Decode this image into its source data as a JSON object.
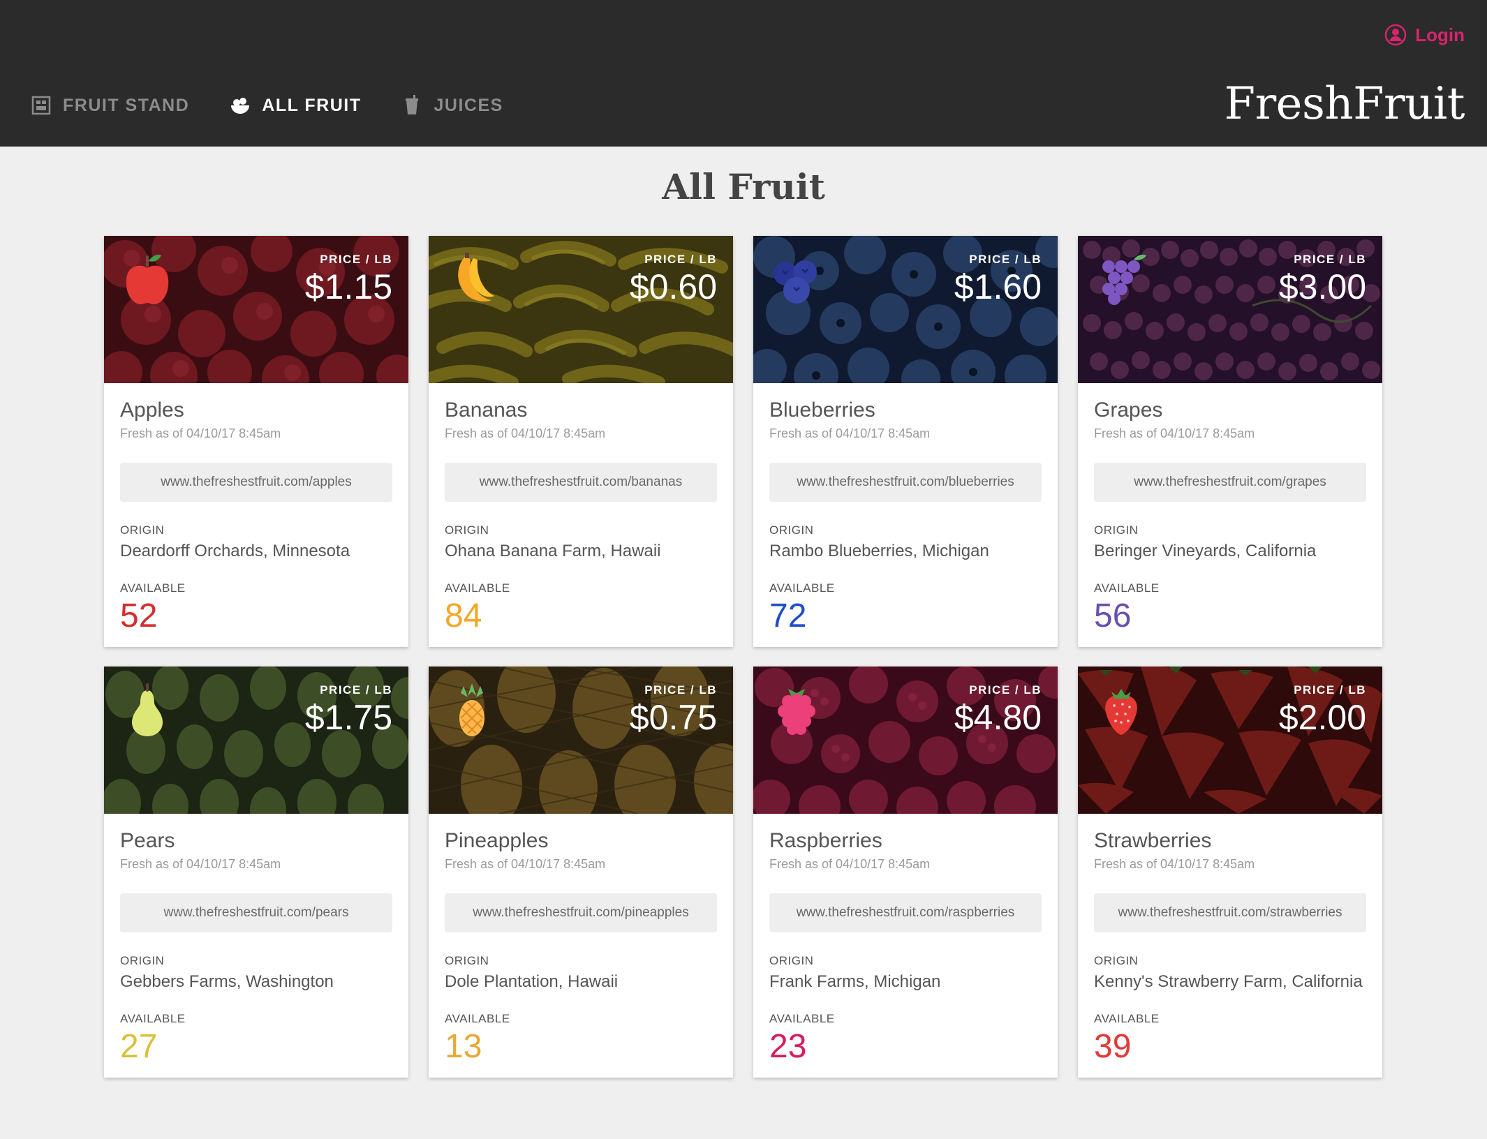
{
  "app": {
    "brand": "FreshFruit",
    "login_label": "Login",
    "accent_color": "#d8246c"
  },
  "nav": {
    "items": [
      {
        "label": "FRUIT STAND",
        "icon": "fruit-stand-icon",
        "active": false
      },
      {
        "label": "ALL FRUIT",
        "icon": "fruit-bowl-icon",
        "active": true
      },
      {
        "label": "JUICES",
        "icon": "juice-cup-icon",
        "active": false
      }
    ]
  },
  "main": {
    "title": "All Fruit",
    "price_label": "PRICE / LB",
    "origin_label": "ORIGIN",
    "available_label": "AVAILABLE",
    "fruits": [
      {
        "name": "Apples",
        "price": "$1.15",
        "fresh": "Fresh as of 04/10/17 8:45am",
        "url": "www.thefreshestfruit.com/apples",
        "origin": "Deardorff Orchards, Minnesota",
        "available": "52",
        "color": "#d32f2f",
        "icon": "apple-icon"
      },
      {
        "name": "Bananas",
        "price": "$0.60",
        "fresh": "Fresh as of 04/10/17 8:45am",
        "url": "www.thefreshestfruit.com/bananas",
        "origin": "Ohana Banana Farm, Hawaii",
        "available": "84",
        "color": "#f5a623",
        "icon": "banana-icon"
      },
      {
        "name": "Blueberries",
        "price": "$1.60",
        "fresh": "Fresh as of 04/10/17 8:45am",
        "url": "www.thefreshestfruit.com/blueberries",
        "origin": "Rambo Blueberries, Michigan",
        "available": "72",
        "color": "#1e4ec8",
        "icon": "blueberry-icon"
      },
      {
        "name": "Grapes",
        "price": "$3.00",
        "fresh": "Fresh as of 04/10/17 8:45am",
        "url": "www.thefreshestfruit.com/grapes",
        "origin": "Beringer Vineyards, California",
        "available": "56",
        "color": "#6a4fb0",
        "icon": "grapes-icon"
      },
      {
        "name": "Pears",
        "price": "$1.75",
        "fresh": "Fresh as of 04/10/17 8:45am",
        "url": "www.thefreshestfruit.com/pears",
        "origin": "Gebbers Farms, Washington",
        "available": "27",
        "color": "#d9c23a",
        "icon": "pear-icon"
      },
      {
        "name": "Pineapples",
        "price": "$0.75",
        "fresh": "Fresh as of 04/10/17 8:45am",
        "url": "www.thefreshestfruit.com/pineapples",
        "origin": "Dole Plantation, Hawaii",
        "available": "13",
        "color": "#e8a83a",
        "icon": "pineapple-icon"
      },
      {
        "name": "Raspberries",
        "price": "$4.80",
        "fresh": "Fresh as of 04/10/17 8:45am",
        "url": "www.thefreshestfruit.com/raspberries",
        "origin": "Frank Farms, Michigan",
        "available": "23",
        "color": "#d81b60",
        "icon": "raspberry-icon"
      },
      {
        "name": "Strawberries",
        "price": "$2.00",
        "fresh": "Fresh as of 04/10/17 8:45am",
        "url": "www.thefreshestfruit.com/strawberries",
        "origin": "Kenny's Strawberry Farm, California",
        "available": "39",
        "color": "#e53935",
        "icon": "strawberry-icon"
      }
    ]
  }
}
